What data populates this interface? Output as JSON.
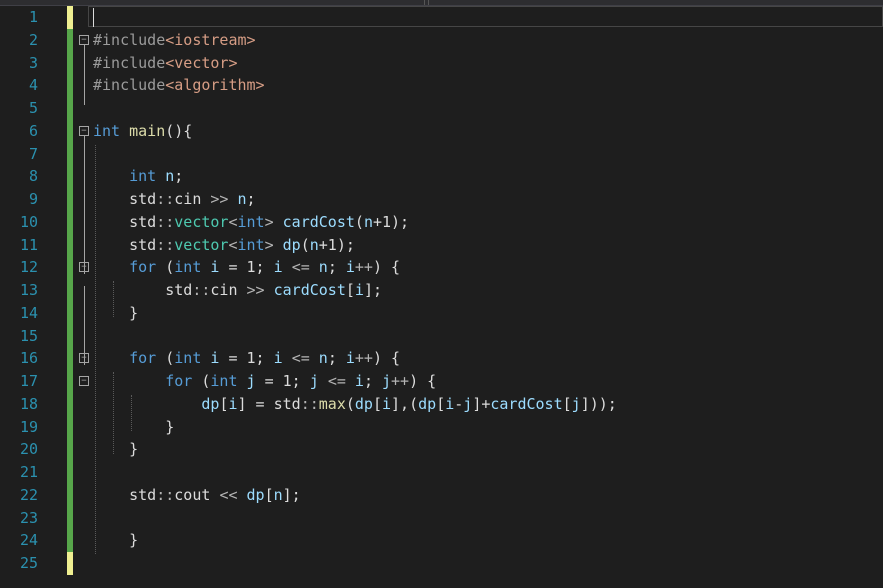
{
  "editor": {
    "colors": {
      "background": "#1e1e1e",
      "line_number": "#2b91af",
      "saved_change": "#57a64a",
      "unsaved_change": "#efef91",
      "keyword": "#569cd6",
      "include_path": "#d69d85"
    },
    "lines": [
      {
        "num": "1"
      },
      {
        "num": "2",
        "tokens": [
          [
            "pp",
            "#include"
          ],
          [
            "str",
            "<iostream>"
          ]
        ]
      },
      {
        "num": "3",
        "tokens": [
          [
            "pp",
            "#include"
          ],
          [
            "str",
            "<vector>"
          ]
        ]
      },
      {
        "num": "4",
        "tokens": [
          [
            "pp",
            "#include"
          ],
          [
            "str",
            "<algorithm>"
          ]
        ]
      },
      {
        "num": "5"
      },
      {
        "num": "6",
        "tokens": [
          [
            "kw",
            "int"
          ],
          [
            "txt",
            " "
          ],
          [
            "fn",
            "main"
          ],
          [
            "txt",
            "(){"
          ]
        ]
      },
      {
        "num": "7"
      },
      {
        "num": "8",
        "tokens": [
          [
            "txt",
            "    "
          ],
          [
            "kw",
            "int"
          ],
          [
            "txt",
            " "
          ],
          [
            "var",
            "n"
          ],
          [
            "txt",
            ";"
          ]
        ]
      },
      {
        "num": "9",
        "tokens": [
          [
            "txt",
            "    std"
          ],
          [
            "op",
            "::"
          ],
          [
            "txt",
            "cin "
          ],
          [
            "op",
            ">>"
          ],
          [
            "txt",
            " "
          ],
          [
            "var",
            "n"
          ],
          [
            "txt",
            ";"
          ]
        ]
      },
      {
        "num": "10",
        "tokens": [
          [
            "txt",
            "    std"
          ],
          [
            "op",
            "::"
          ],
          [
            "ty",
            "vector"
          ],
          [
            "op",
            "<"
          ],
          [
            "kw",
            "int"
          ],
          [
            "op",
            ">"
          ],
          [
            "txt",
            " "
          ],
          [
            "var",
            "cardCost"
          ],
          [
            "txt",
            "("
          ],
          [
            "var",
            "n"
          ],
          [
            "txt",
            "+1);"
          ]
        ]
      },
      {
        "num": "11",
        "tokens": [
          [
            "txt",
            "    std"
          ],
          [
            "op",
            "::"
          ],
          [
            "ty",
            "vector"
          ],
          [
            "op",
            "<"
          ],
          [
            "kw",
            "int"
          ],
          [
            "op",
            ">"
          ],
          [
            "txt",
            " "
          ],
          [
            "var",
            "dp"
          ],
          [
            "txt",
            "("
          ],
          [
            "var",
            "n"
          ],
          [
            "txt",
            "+1);"
          ]
        ]
      },
      {
        "num": "12",
        "tokens": [
          [
            "txt",
            "    "
          ],
          [
            "kw",
            "for"
          ],
          [
            "txt",
            " ("
          ],
          [
            "kw",
            "int"
          ],
          [
            "txt",
            " "
          ],
          [
            "var",
            "i"
          ],
          [
            "txt",
            " = 1; "
          ],
          [
            "var",
            "i"
          ],
          [
            "txt",
            " "
          ],
          [
            "op",
            "<="
          ],
          [
            "txt",
            " "
          ],
          [
            "var",
            "n"
          ],
          [
            "txt",
            "; "
          ],
          [
            "var",
            "i"
          ],
          [
            "op",
            "++"
          ],
          [
            "txt",
            ") {"
          ]
        ]
      },
      {
        "num": "13",
        "tokens": [
          [
            "txt",
            "        std"
          ],
          [
            "op",
            "::"
          ],
          [
            "txt",
            "cin "
          ],
          [
            "op",
            ">>"
          ],
          [
            "txt",
            " "
          ],
          [
            "var",
            "cardCost"
          ],
          [
            "txt",
            "["
          ],
          [
            "var",
            "i"
          ],
          [
            "txt",
            "];"
          ]
        ]
      },
      {
        "num": "14",
        "tokens": [
          [
            "txt",
            "    }"
          ]
        ]
      },
      {
        "num": "15"
      },
      {
        "num": "16",
        "tokens": [
          [
            "txt",
            "    "
          ],
          [
            "kw",
            "for"
          ],
          [
            "txt",
            " ("
          ],
          [
            "kw",
            "int"
          ],
          [
            "txt",
            " "
          ],
          [
            "var",
            "i"
          ],
          [
            "txt",
            " = 1; "
          ],
          [
            "var",
            "i"
          ],
          [
            "txt",
            " "
          ],
          [
            "op",
            "<="
          ],
          [
            "txt",
            " "
          ],
          [
            "var",
            "n"
          ],
          [
            "txt",
            "; "
          ],
          [
            "var",
            "i"
          ],
          [
            "op",
            "++"
          ],
          [
            "txt",
            ") {"
          ]
        ]
      },
      {
        "num": "17",
        "tokens": [
          [
            "txt",
            "        "
          ],
          [
            "kw",
            "for"
          ],
          [
            "txt",
            " ("
          ],
          [
            "kw",
            "int"
          ],
          [
            "txt",
            " "
          ],
          [
            "var",
            "j"
          ],
          [
            "txt",
            " = 1; "
          ],
          [
            "var",
            "j"
          ],
          [
            "txt",
            " "
          ],
          [
            "op",
            "<="
          ],
          [
            "txt",
            " "
          ],
          [
            "var",
            "i"
          ],
          [
            "txt",
            "; "
          ],
          [
            "var",
            "j"
          ],
          [
            "op",
            "++"
          ],
          [
            "txt",
            ") {"
          ]
        ]
      },
      {
        "num": "18",
        "tokens": [
          [
            "txt",
            "            "
          ],
          [
            "var",
            "dp"
          ],
          [
            "txt",
            "["
          ],
          [
            "var",
            "i"
          ],
          [
            "txt",
            "] = std"
          ],
          [
            "op",
            "::"
          ],
          [
            "fn",
            "max"
          ],
          [
            "txt",
            "("
          ],
          [
            "var",
            "dp"
          ],
          [
            "txt",
            "["
          ],
          [
            "var",
            "i"
          ],
          [
            "txt",
            "],("
          ],
          [
            "var",
            "dp"
          ],
          [
            "txt",
            "["
          ],
          [
            "var",
            "i"
          ],
          [
            "txt",
            "-"
          ],
          [
            "var",
            "j"
          ],
          [
            "txt",
            "]+"
          ],
          [
            "var",
            "cardCost"
          ],
          [
            "txt",
            "["
          ],
          [
            "var",
            "j"
          ],
          [
            "txt",
            "]));"
          ]
        ]
      },
      {
        "num": "19",
        "tokens": [
          [
            "txt",
            "        }"
          ]
        ]
      },
      {
        "num": "20",
        "tokens": [
          [
            "txt",
            "    }"
          ]
        ]
      },
      {
        "num": "21"
      },
      {
        "num": "22",
        "tokens": [
          [
            "txt",
            "    std"
          ],
          [
            "op",
            "::"
          ],
          [
            "txt",
            "cout "
          ],
          [
            "op",
            "<<"
          ],
          [
            "txt",
            " "
          ],
          [
            "var",
            "dp"
          ],
          [
            "txt",
            "["
          ],
          [
            "var",
            "n"
          ],
          [
            "txt",
            "];"
          ]
        ]
      },
      {
        "num": "23"
      },
      {
        "num": "24",
        "tokens": [
          [
            "txt",
            "    }"
          ]
        ]
      },
      {
        "num": "25"
      }
    ]
  }
}
